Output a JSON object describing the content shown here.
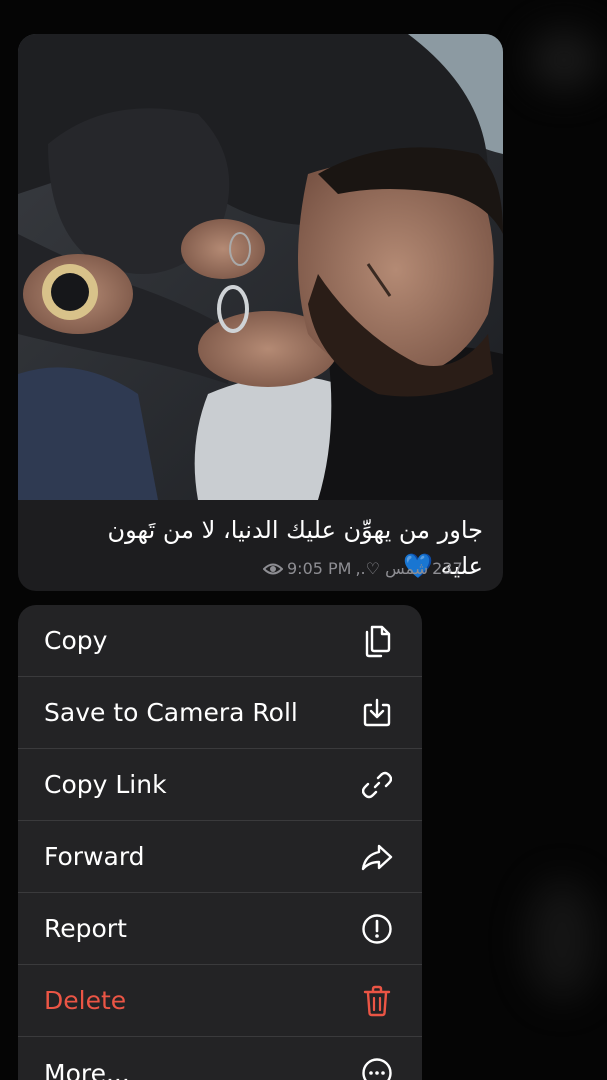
{
  "message": {
    "caption_line1": "جاور من يهوِّن عليك الدنيا، لا من تَهون",
    "caption_line2": "عليه",
    "caption_emoji": "💙",
    "views": "237",
    "sender_signature": "شمس ♡.,",
    "time": "9:05 PM",
    "views_icon": "eye-icon"
  },
  "menu": {
    "items": [
      {
        "label": "Copy",
        "icon": "copy-icon"
      },
      {
        "label": "Save to Camera Roll",
        "icon": "download-icon"
      },
      {
        "label": "Copy Link",
        "icon": "link-icon"
      },
      {
        "label": "Forward",
        "icon": "forward-arrow-icon"
      },
      {
        "label": "Report",
        "icon": "exclamation-circle-icon"
      },
      {
        "label": "Delete",
        "icon": "trash-icon",
        "color": "#eb5545"
      },
      {
        "label": "More...",
        "icon": "more-circle-icon"
      }
    ]
  }
}
